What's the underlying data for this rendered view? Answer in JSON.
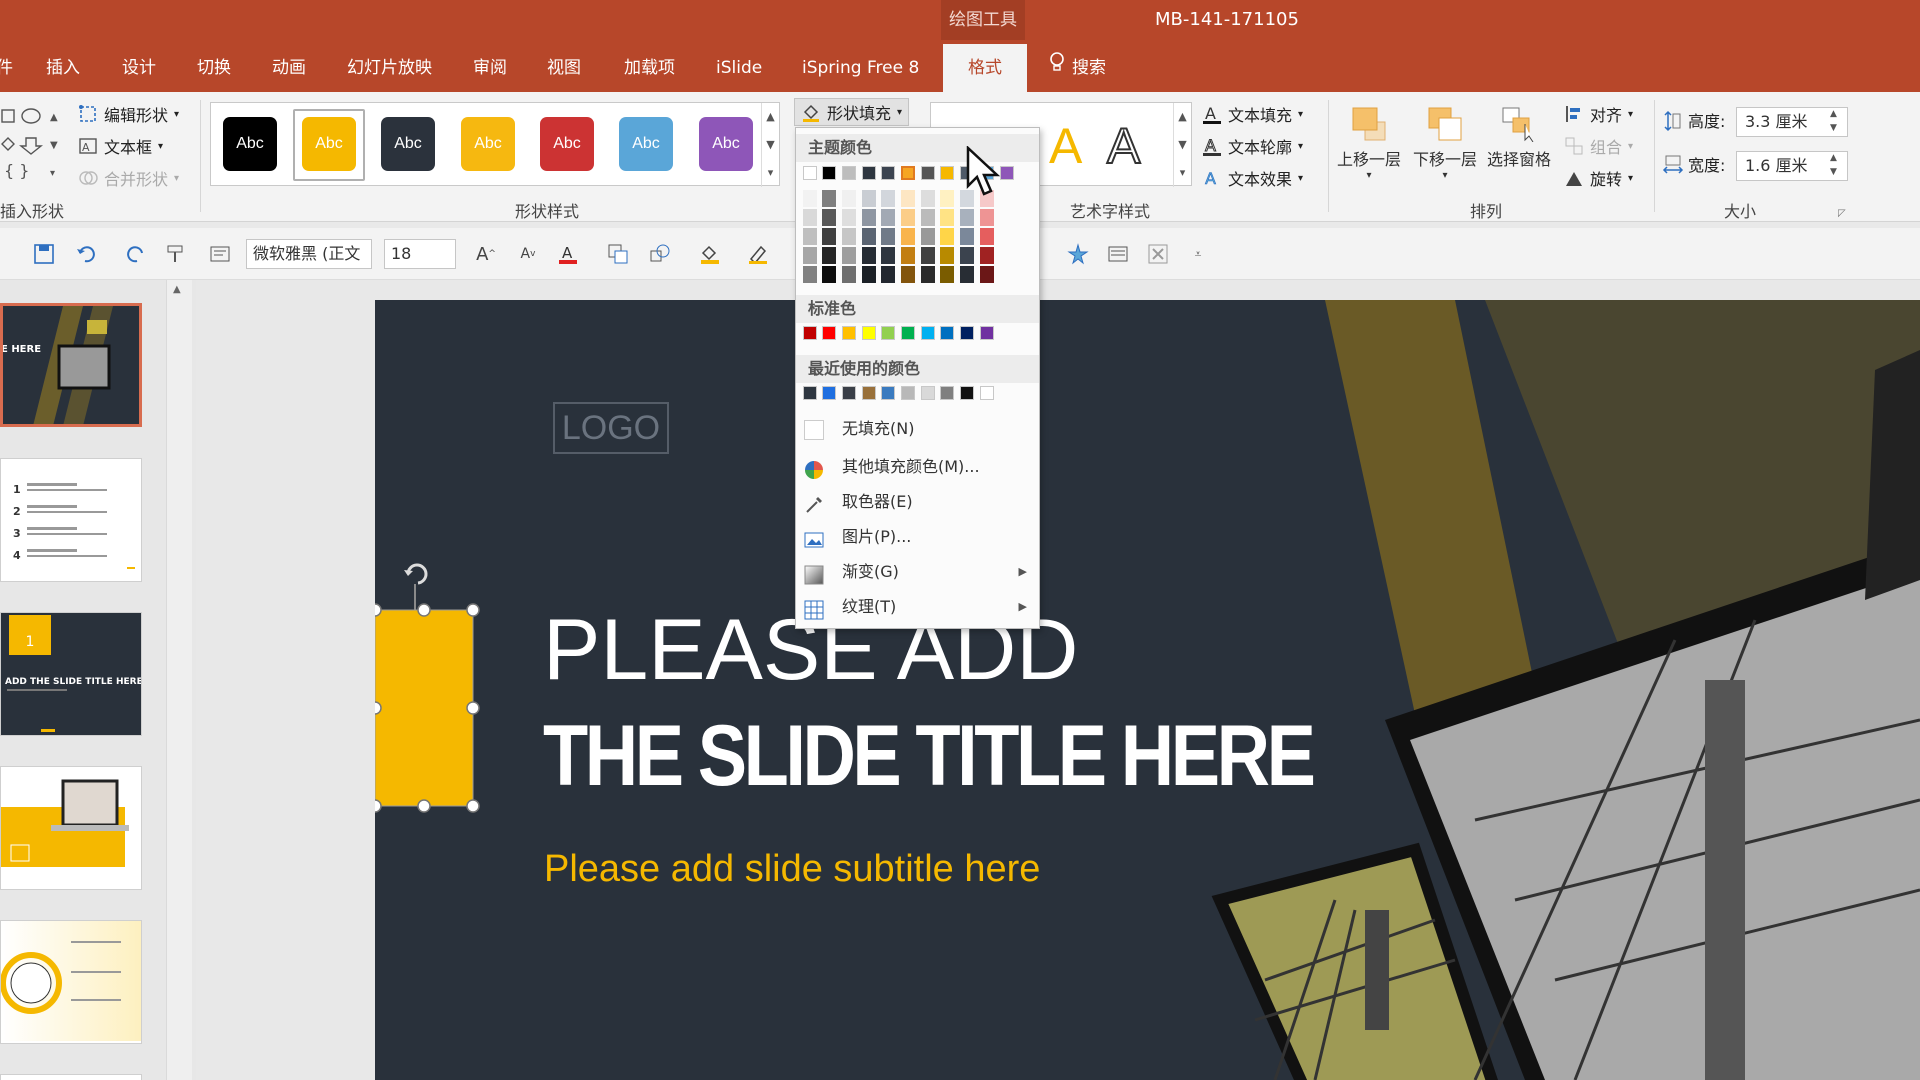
{
  "titlebar": {
    "context_tool": "绘图工具",
    "doc_title": "MB-141-171105"
  },
  "tabs": [
    {
      "label": "件"
    },
    {
      "label": "插入"
    },
    {
      "label": "设计"
    },
    {
      "label": "切换"
    },
    {
      "label": "动画"
    },
    {
      "label": "幻灯片放映"
    },
    {
      "label": "审阅"
    },
    {
      "label": "视图"
    },
    {
      "label": "加载项"
    },
    {
      "label": "iSlide"
    },
    {
      "label": "iSpring Free 8"
    },
    {
      "label": "格式"
    },
    {
      "label": "搜索"
    }
  ],
  "ribbon": {
    "insert_shapes": {
      "edit_shape": "编辑形状",
      "text_box": "文本框",
      "merge_shapes": "合并形状",
      "label": "插入形状"
    },
    "shape_styles": {
      "label": "形状样式",
      "styles": [
        {
          "text": "Abc",
          "color": "#000000"
        },
        {
          "text": "Abc",
          "color": "#f5b800"
        },
        {
          "text": "Abc",
          "color": "#2b323c"
        },
        {
          "text": "Abc",
          "color": "#f6b810"
        },
        {
          "text": "Abc",
          "color": "#cc3333"
        },
        {
          "text": "Abc",
          "color": "#5aa6d8"
        },
        {
          "text": "Abc",
          "color": "#8e56b8"
        }
      ],
      "fill_button": "形状填充"
    },
    "wordart": {
      "label": "艺术字样式",
      "text_fill": "文本填充",
      "text_outline": "文本轮廓",
      "text_effect": "文本效果",
      "sample": "A"
    },
    "arrange": {
      "label": "排列",
      "bring_forward": "上移一层",
      "send_backward": "下移一层",
      "selection_pane": "选择窗格",
      "align": "对齐",
      "group": "组合",
      "rotate": "旋转"
    },
    "size": {
      "label": "大小",
      "height_label": "高度:",
      "height_value": "3.3 厘米",
      "width_label": "宽度:",
      "width_value": "1.6 厘米"
    }
  },
  "qat": {
    "font": "微软雅黑 (正文",
    "font_size": "18"
  },
  "dropdown": {
    "theme_colors_label": "主题颜色",
    "theme_top": [
      "#ffffff",
      "#000000",
      "#bdbdbd",
      "#2e3640",
      "#3c4450",
      "#f6a623",
      "#555555",
      "#f6b800",
      "#4f5a68",
      "#5aa6d8",
      "#8e56b8"
    ],
    "theme_columns": [
      [
        "#f2f2f2",
        "#d9d9d9",
        "#bfbfbf",
        "#a6a6a6",
        "#808080"
      ],
      [
        "#7f7f7f",
        "#595959",
        "#404040",
        "#262626",
        "#0d0d0d"
      ],
      [
        "#f0f0f0",
        "#dedede",
        "#c6c6c6",
        "#9e9e9e",
        "#6e6e6e"
      ],
      [
        "#c9cdd3",
        "#8e96a2",
        "#5a6472",
        "#262c34",
        "#1b2026"
      ],
      [
        "#d2d6dc",
        "#a2a9b4",
        "#707a88",
        "#2e353f",
        "#22272f"
      ],
      [
        "#fde6c3",
        "#fbcd88",
        "#f9b44c",
        "#c27e12",
        "#82540c"
      ],
      [
        "#dddddd",
        "#bbbbbb",
        "#999999",
        "#404040",
        "#2a2a2a"
      ],
      [
        "#fff1c2",
        "#ffe385",
        "#ffd548",
        "#b88a00",
        "#7a5c00"
      ],
      [
        "#d3d8de",
        "#a8b1bd",
        "#7b889a",
        "#3b434e",
        "#282d34"
      ],
      [
        "#f6c9c9",
        "#ee9494",
        "#e55e5e",
        "#a02222",
        "#6b1717"
      ],
      [
        "#deedf7",
        "#bcdbf0",
        "#9bc9e8",
        "#2e7db3",
        "#1f5377"
      ],
      [
        "#e8ddf1",
        "#d2bbe3",
        "#bb99d5",
        "#6a3791",
        "#472560"
      ]
    ],
    "standard_label": "标准色",
    "standard": [
      "#c00000",
      "#ff0000",
      "#ffc000",
      "#ffff00",
      "#92d050",
      "#00b050",
      "#00b0f0",
      "#0070c0",
      "#002060",
      "#7030a0"
    ],
    "recent_label": "最近使用的颜色",
    "recent": [
      "#2e3640",
      "#1f6fe0",
      "#3a3f47",
      "#98703a",
      "#3a7abf",
      "#b8b8b8",
      "#d9d9d9",
      "#7f7f7f",
      "#111111",
      "#ffffff"
    ],
    "no_fill": "无填充(N)",
    "more_colors": "其他填充颜色(M)...",
    "eyedropper": "取色器(E)",
    "picture": "图片(P)...",
    "gradient": "渐变(G)",
    "texture": "纹理(T)"
  },
  "slide": {
    "logo": "LOGO",
    "title_line1": "PLEASE ADD",
    "title_line2": "THE SLIDE TITLE HERE",
    "subtitle": "Please add slide subtitle here",
    "accent": "#f5b800",
    "background": "#29313b"
  },
  "thumbnails": [
    {
      "index": 1,
      "caption": "E HERE"
    },
    {
      "index": 2,
      "items": [
        "1",
        "2",
        "3",
        "4"
      ]
    },
    {
      "index": 3,
      "caption": "ADD THE SLIDE TITLE HERE",
      "num": "1"
    },
    {
      "index": 4
    },
    {
      "index": 5
    }
  ]
}
